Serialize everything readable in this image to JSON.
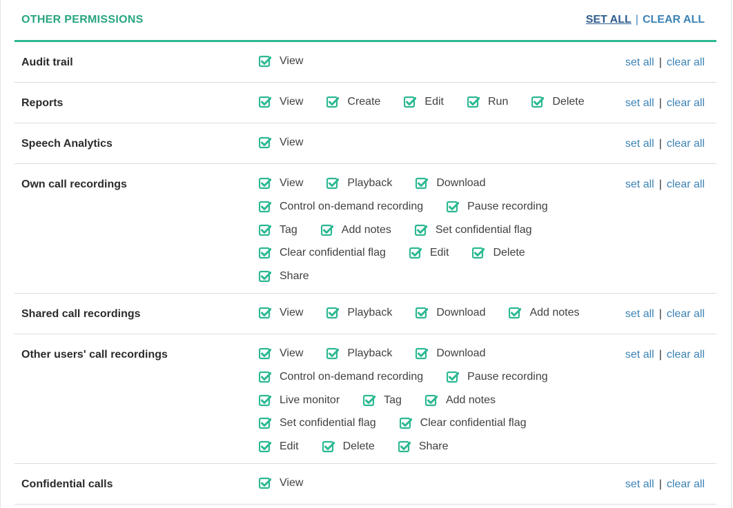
{
  "header": {
    "title": "OTHER PERMISSIONS",
    "set_all": "SET ALL",
    "separator": "|",
    "clear_all": "CLEAR ALL"
  },
  "row_actions": {
    "set_all": "set all",
    "separator": "|",
    "clear_all": "clear all"
  },
  "accent_color": "#2bb892",
  "checkbox_icon": "checked-checkbox-icon",
  "rows": [
    {
      "id": "audit-trail",
      "label": "Audit trail",
      "lines": [
        [
          "View"
        ]
      ]
    },
    {
      "id": "reports",
      "label": "Reports",
      "lines": [
        [
          "View",
          "Create",
          "Edit",
          "Run",
          "Delete"
        ]
      ]
    },
    {
      "id": "speech-analytics",
      "label": "Speech Analytics",
      "lines": [
        [
          "View"
        ]
      ]
    },
    {
      "id": "own-call-recordings",
      "label": "Own call recordings",
      "lines": [
        [
          "View",
          "Playback",
          "Download"
        ],
        [
          "Control on-demand recording",
          "Pause recording"
        ],
        [
          "Tag",
          "Add notes",
          "Set confidential flag"
        ],
        [
          "Clear confidential flag",
          "Edit",
          "Delete"
        ],
        [
          "Share"
        ]
      ]
    },
    {
      "id": "shared-call-recordings",
      "label": "Shared call recordings",
      "lines": [
        [
          "View",
          "Playback",
          "Download",
          "Add notes"
        ]
      ]
    },
    {
      "id": "other-users-call-recordings",
      "label": "Other users' call recordings",
      "lines": [
        [
          "View",
          "Playback",
          "Download"
        ],
        [
          "Control on-demand recording",
          "Pause recording"
        ],
        [
          "Live monitor",
          "Tag",
          "Add notes"
        ],
        [
          "Set confidential flag",
          "Clear confidential flag"
        ],
        [
          "Edit",
          "Delete",
          "Share"
        ]
      ]
    },
    {
      "id": "confidential-calls",
      "label": "Confidential calls",
      "lines": [
        [
          "View"
        ]
      ]
    }
  ]
}
